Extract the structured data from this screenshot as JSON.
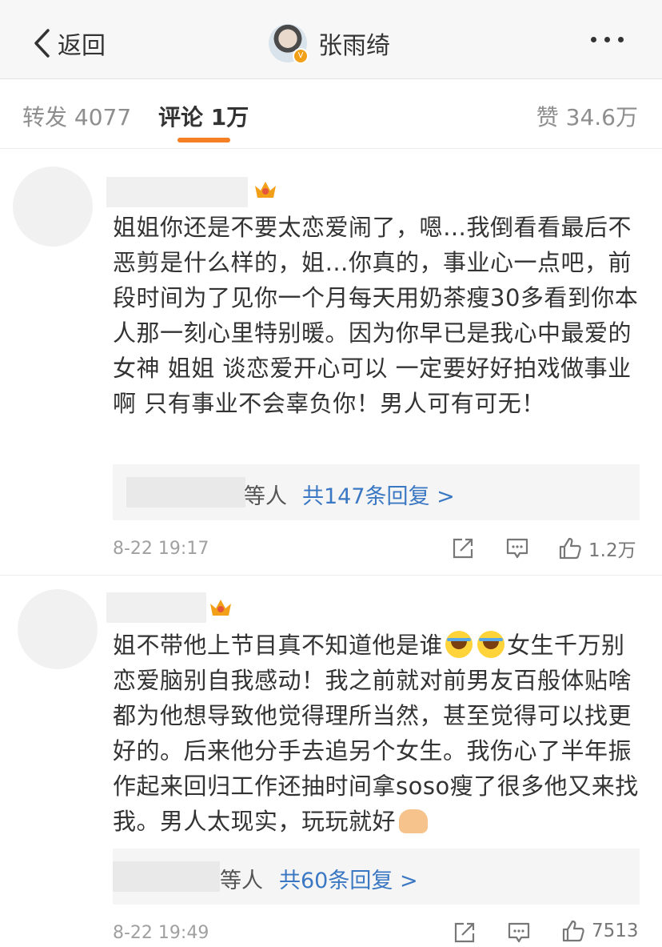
{
  "header": {
    "back_label": "返回",
    "profile_name": "张雨绮",
    "verified_badge": "V"
  },
  "tabs": [
    {
      "label": "转发 4077"
    },
    {
      "label": "评论 1万"
    },
    {
      "label": "赞 34.6万"
    }
  ],
  "comments": [
    {
      "text": "姐姐你还是不要太恋爱闹了，嗯…我倒看看最后不恶剪是什么样的，姐…你真的，事业心一点吧，前段时间为了见你一个月每天用奶茶瘦30多看到你本人那一刻心里特别暖。因为你早已是我心中最爱的女神 姐姐 谈恋爱开心可以 一定要好好拍戏做事业啊 只有事业不会辜负你！男人可有可无！",
      "reply_who": "等人",
      "reply_link": "共147条回复 >",
      "time": "8-22 19:17",
      "likes": "1.2万"
    },
    {
      "text_part1": "姐不带他上节目真不知道他是谁",
      "text_part2": "女生千万别恋爱脑别自我感动！我之前就对前男友百般体贴啥都为他想导致他觉得理所当然，甚至觉得可以找更好的。后来他分手去追另个女生。我伤心了半年振作起来回归工作还抽时间拿soso瘦了很多他又来找我。男人太现实，玩玩就好",
      "reply_who": "等人",
      "reply_link": "共60条回复 >",
      "time": "8-22 19:49",
      "likes": "7513"
    }
  ],
  "colors": {
    "accent": "#f57f23",
    "link": "#3b78c3",
    "crown": "#f3a019"
  },
  "icons": [
    "chevron-left-icon",
    "more-dots-icon",
    "crown-icon",
    "share-icon",
    "comment-icon",
    "thumbs-up-icon",
    "laughing-crying-emoji",
    "praying-hands-emoji"
  ]
}
